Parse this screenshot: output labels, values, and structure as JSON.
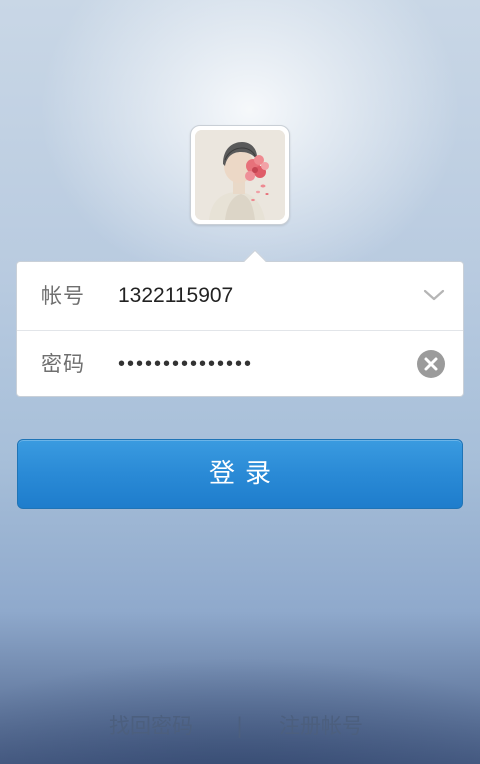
{
  "login_form": {
    "account_label": "帐号",
    "account_value": "1322115907",
    "password_label": "密码",
    "password_value": "•••••••••••••••"
  },
  "login_button": {
    "label": "登录"
  },
  "footer": {
    "forgot_password": "找回密码",
    "divider": "|",
    "register": "注册帐号"
  },
  "icons": {
    "account_dropdown": "chevron-down-icon",
    "password_clear": "close-icon"
  },
  "colors": {
    "primary_button": "#2a8ad6",
    "footer_link": "#4c5f7e"
  }
}
